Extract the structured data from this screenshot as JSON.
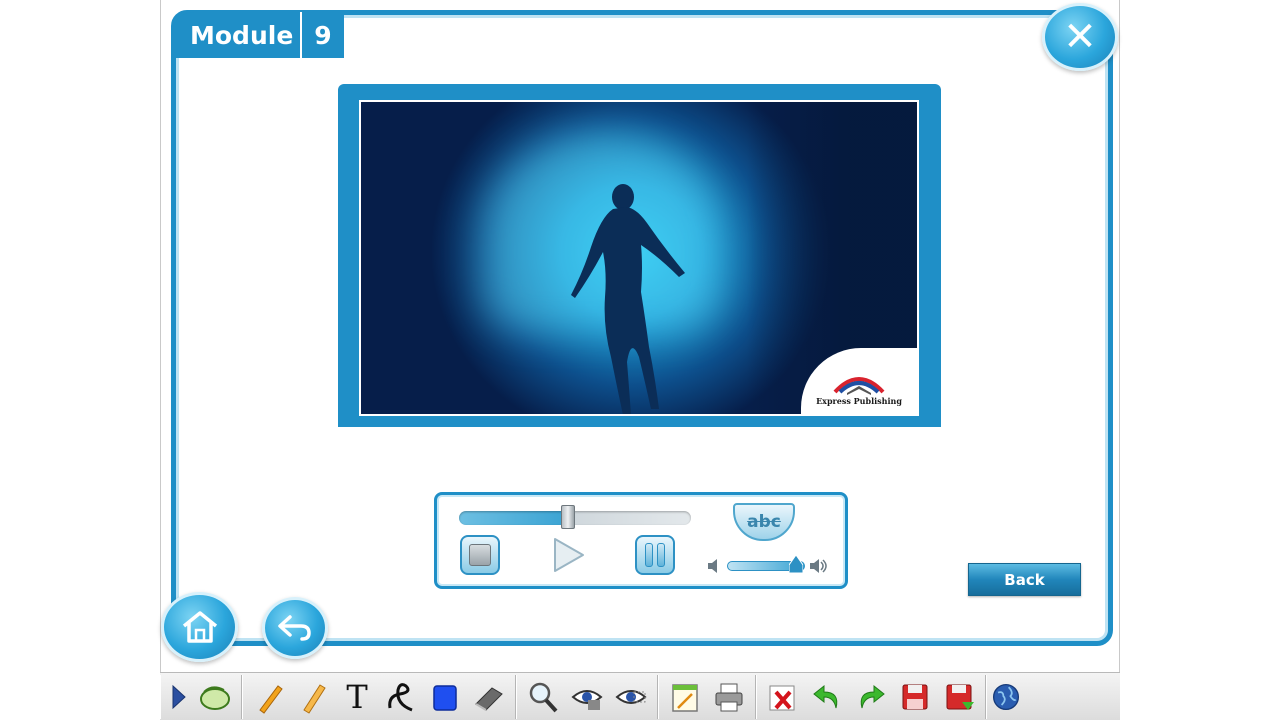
{
  "header": {
    "module_label": "Module",
    "module_number": "9"
  },
  "video": {
    "logo_text": "Express Publishing"
  },
  "player": {
    "progress_fraction": 0.47,
    "volume_fraction": 0.88,
    "subtitles_label": "abc"
  },
  "back_label": "Back",
  "toolbar": {
    "text_tool_label": "T",
    "items": [
      "expand-arrow-icon",
      "mouse-icon",
      "pencil-icon",
      "marker-icon",
      "text-tool-icon",
      "freehand-icon",
      "shape-icon",
      "eraser-icon",
      "zoom-icon",
      "reveal-icon",
      "hide-icon",
      "notes-icon",
      "print-icon",
      "clear-icon",
      "undo-icon",
      "redo-icon",
      "save-icon",
      "save-as-icon",
      "globe-icon"
    ]
  },
  "colors": {
    "accent": "#1f8fc7",
    "accent_light": "#bfe3f3"
  }
}
